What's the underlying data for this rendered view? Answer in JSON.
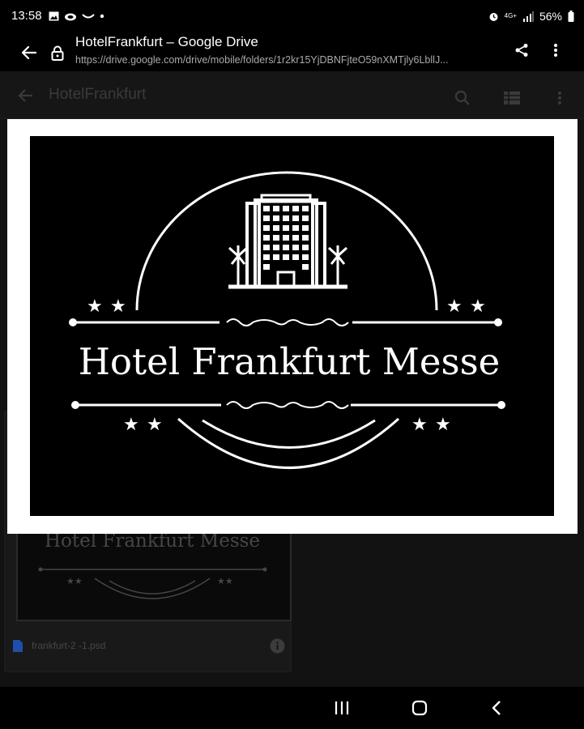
{
  "status_bar": {
    "time": "13:58",
    "network": "4G+",
    "battery": "56%",
    "left_icons": [
      "gallery-icon",
      "cloud-icon",
      "whatsapp-icon",
      "dot-icon"
    ],
    "right_icons": [
      "alarm-icon",
      "network-icon",
      "signal-icon",
      "battery-icon"
    ]
  },
  "browser": {
    "title": "HotelFrankfurt – Google Drive",
    "url": "https://drive.google.com/drive/mobile/folders/1r2kr15YjDBNFjteO59nXMTjly6LbllJ...",
    "back_icon": "arrow-back-icon",
    "lock_icon": "lock-icon",
    "share_icon": "share-icon",
    "menu_icon": "more-vert-icon"
  },
  "drive": {
    "folder_title": "HotelFrankfurt",
    "icons": [
      "arrow-back-icon",
      "search-icon",
      "list-view-icon",
      "more-vert-icon"
    ],
    "file": {
      "name": "frankfurt-2 -1.psd",
      "thumb_text": "Hotel Frankfurt Messe",
      "file_icon": "document-icon",
      "info_icon": "info-icon"
    }
  },
  "logo": {
    "text": "Hotel Frankfurt Messe",
    "colors": {
      "foreground": "#ffffff",
      "background": "#000000",
      "frame": "#ffffff"
    }
  },
  "system_nav": {
    "icons": [
      "recent-apps-icon",
      "home-icon",
      "back-icon"
    ]
  }
}
